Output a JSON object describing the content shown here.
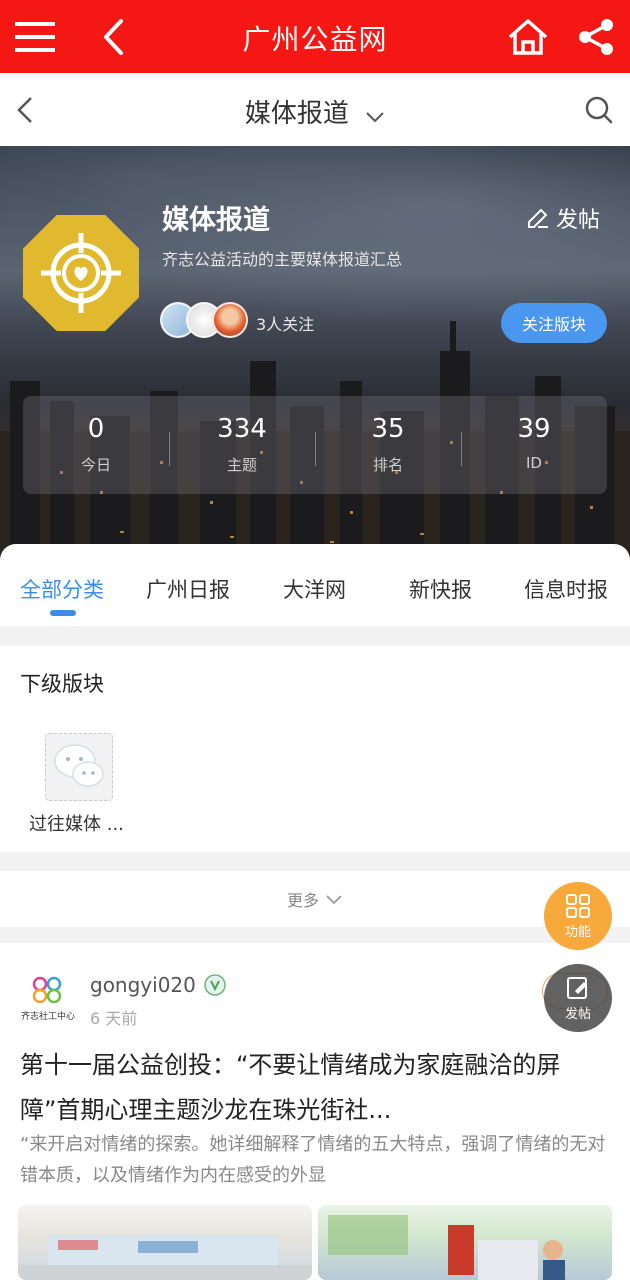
{
  "appbar": {
    "title": "广州公益网",
    "icons": [
      "menu-icon",
      "back-icon",
      "home-icon",
      "share-icon"
    ]
  },
  "subbar": {
    "title": "媒体报道",
    "icons": [
      "back-icon",
      "chevron-down-icon",
      "search-icon"
    ]
  },
  "forum": {
    "title": "媒体报道",
    "description": "齐志公益活动的主要媒体报道汇总",
    "post_label": "发帖",
    "followers_text": "3人关注",
    "follow_button": "关注版块",
    "stats": [
      {
        "value": "0",
        "label": "今日"
      },
      {
        "value": "334",
        "label": "主题"
      },
      {
        "value": "35",
        "label": "排名"
      },
      {
        "value": "39",
        "label": "ID"
      }
    ]
  },
  "tabs": [
    "全部分类",
    "广州日报",
    "大洋网",
    "新快报",
    "信息时报"
  ],
  "subforum": {
    "heading": "下级版块",
    "items": [
      {
        "label": "过往媒体 ..."
      }
    ]
  },
  "more_label": "更多",
  "post": {
    "org_name": "齐志社工中心",
    "username": "gongyi020",
    "time": "6 天前",
    "title": "第十一届公益创投：“不要让情绪成为家庭融洽的屏障”首期心理主题沙龙在珠光街社...",
    "excerpt": "“来开启对情绪的探索。她详细解释了情绪的五大特点，强调了情绪的无对错本质，以及情绪作为内在感受的外显"
  },
  "fab": {
    "function_label": "功能",
    "post_label": "发帖"
  },
  "colors": {
    "appbar": "#f51713",
    "accent": "#3b8ee8",
    "logo": "#e0b92f",
    "fab_orange": "#f7a93b"
  }
}
